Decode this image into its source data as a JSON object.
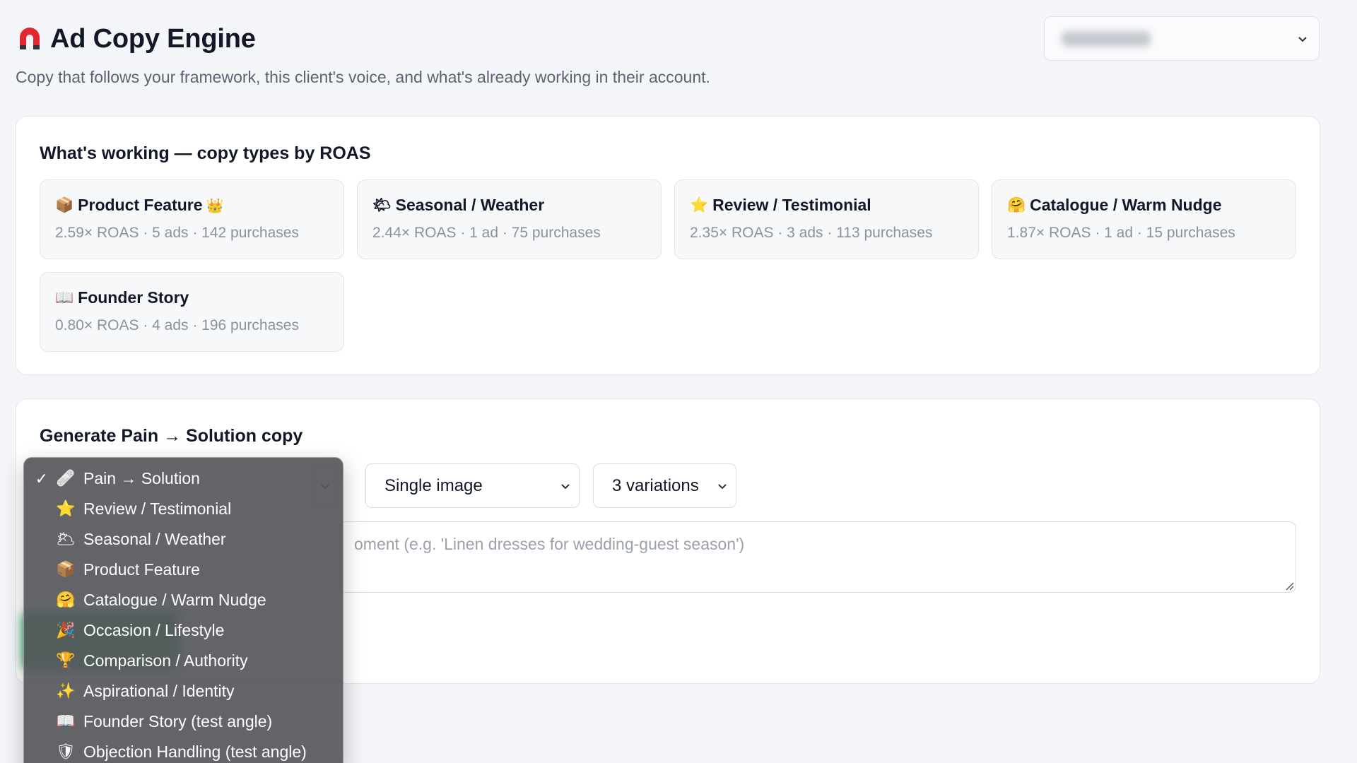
{
  "app": {
    "title": "Ad Copy Engine",
    "logo_icon": "magnet-icon",
    "subtitle": "Copy that follows your framework, this client's voice, and what's already working in their account."
  },
  "client_selector": {
    "value_obscured": true
  },
  "whats_working": {
    "title": "What's working — copy types by ROAS",
    "tiles": [
      {
        "emoji": "📦",
        "name": "Product Feature",
        "badge": "👑",
        "stats": "2.59× ROAS · 5 ads · 142 purchases"
      },
      {
        "emoji": "🌤",
        "name": "Seasonal / Weather",
        "badge": "",
        "stats": "2.44× ROAS · 1 ad · 75 purchases"
      },
      {
        "emoji": "⭐",
        "name": "Review / Testimonial",
        "badge": "",
        "stats": "2.35× ROAS · 3 ads · 113 purchases"
      },
      {
        "emoji": "🤗",
        "name": "Catalogue / Warm Nudge",
        "badge": "",
        "stats": "1.87× ROAS · 1 ad · 15 purchases"
      },
      {
        "emoji": "📖",
        "name": "Founder Story",
        "badge": "",
        "stats": "0.80× ROAS · 4 ads · 196 purchases"
      }
    ]
  },
  "generate": {
    "title": "Generate Pain → Solution copy",
    "format_select": "Single image",
    "variations_select": "3 variations",
    "brief_placeholder": "oment (e.g. 'Linen dresses for wedding-guest season')"
  },
  "copy_type_menu": {
    "selected_index": 0,
    "options": [
      {
        "icon": "🩹",
        "label": "Pain → Solution",
        "checked": "✓"
      },
      {
        "icon": "⭐",
        "label": "Review / Testimonial",
        "checked": ""
      },
      {
        "icon": "🌥",
        "label": "Seasonal / Weather",
        "checked": ""
      },
      {
        "icon": "📦",
        "label": "Product Feature",
        "checked": ""
      },
      {
        "icon": "🤗",
        "label": "Catalogue / Warm Nudge",
        "checked": ""
      },
      {
        "icon": "🎉",
        "label": "Occasion / Lifestyle",
        "checked": ""
      },
      {
        "icon": "🏆",
        "label": "Comparison / Authority",
        "checked": ""
      },
      {
        "icon": "✨",
        "label": "Aspirational / Identity",
        "checked": ""
      },
      {
        "icon": "📖",
        "label": "Founder Story (test angle)",
        "checked": ""
      },
      {
        "icon": "🛡",
        "label": "Objection Handling (test angle)",
        "checked": ""
      }
    ]
  },
  "colors": {
    "background": "#f3f5f8",
    "card": "#ffffff",
    "menu_bg": "#56585c",
    "accent_green": "#1f9a55",
    "magnet_red": "#e0282e"
  }
}
